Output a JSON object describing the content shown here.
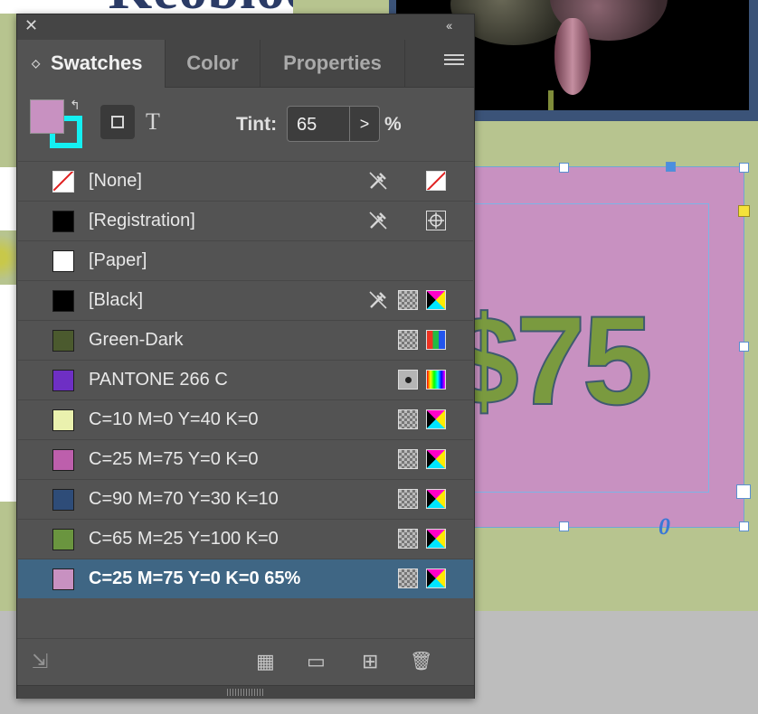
{
  "document": {
    "heading_fragment": "Keobloom",
    "price_text": "$75",
    "link_badge": "0"
  },
  "panel": {
    "tabs": [
      {
        "label": "Swatches",
        "active": true
      },
      {
        "label": "Color",
        "active": false
      },
      {
        "label": "Properties",
        "active": false
      }
    ],
    "tint": {
      "label": "Tint:",
      "value": "65",
      "arrow": ">",
      "unit": "%"
    },
    "fill_color": "#c891c1",
    "stroke_color": "#14f0f2",
    "text_icon": "T",
    "swatches": [
      {
        "name": "[None]",
        "color": "none",
        "selected": false
      },
      {
        "name": "[Registration]",
        "color": "#000000",
        "selected": false
      },
      {
        "name": "[Paper]",
        "color": "#ffffff",
        "selected": false
      },
      {
        "name": "[Black]",
        "color": "#000000",
        "selected": false
      },
      {
        "name": "Green-Dark",
        "color": "#4b5a2e",
        "selected": false
      },
      {
        "name": "PANTONE 266 C",
        "color": "#6e2fc4",
        "selected": false
      },
      {
        "name": "C=10 M=0 Y=40 K=0",
        "color": "#eaf1ae",
        "selected": false
      },
      {
        "name": "C=25 M=75 Y=0 K=0",
        "color": "#bd5fac",
        "selected": false
      },
      {
        "name": "C=90 M=70 Y=30 K=10",
        "color": "#2e4c78",
        "selected": false
      },
      {
        "name": "C=65 M=25 Y=100 K=0",
        "color": "#6a953f",
        "selected": false
      },
      {
        "name": "C=25 M=75 Y=0 K=0 65%",
        "color": "#c891c1",
        "selected": true
      }
    ],
    "icons": {
      "close": "✕",
      "collapse": "‹‹",
      "swap": "↰",
      "load": "⇲",
      "grid": "▦",
      "folder": "▭",
      "new": "⊞",
      "trash": "🗑"
    }
  }
}
